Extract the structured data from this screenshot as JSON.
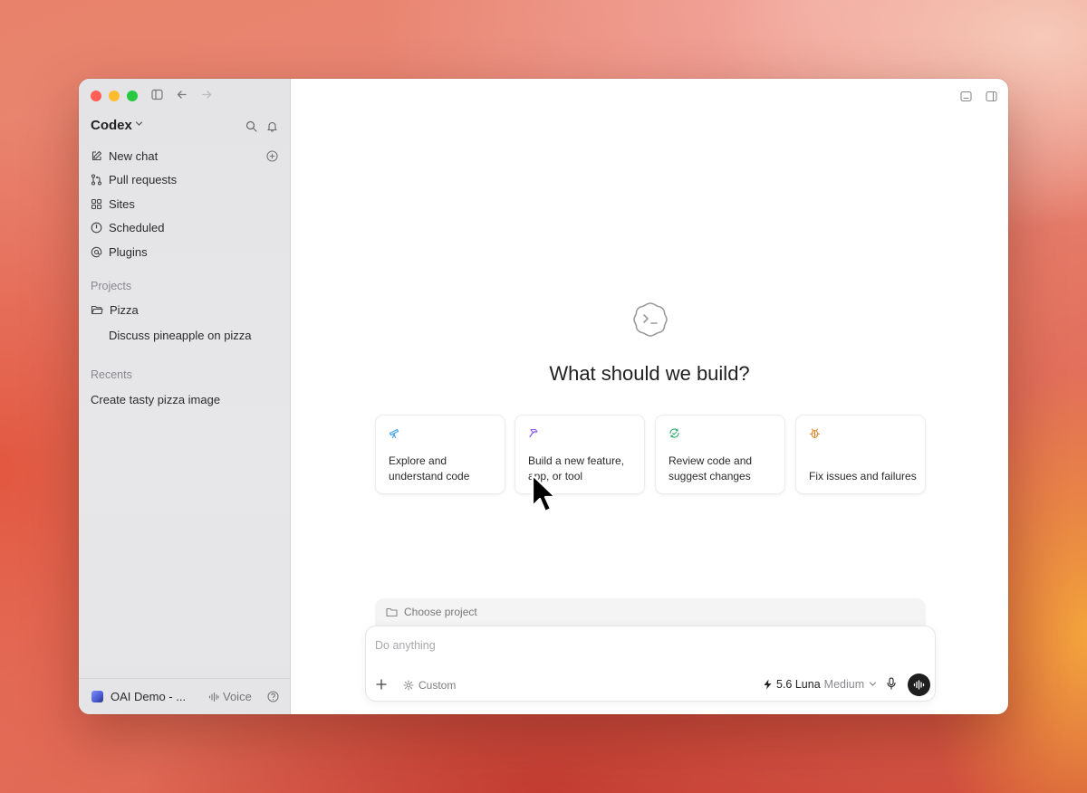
{
  "sidebar": {
    "brand": "Codex",
    "nav": [
      {
        "label": "New chat",
        "icon": "edit-icon"
      },
      {
        "label": "Pull requests",
        "icon": "git-pull-request-icon"
      },
      {
        "label": "Sites",
        "icon": "grid-icon"
      },
      {
        "label": "Scheduled",
        "icon": "clock-icon"
      },
      {
        "label": "Plugins",
        "icon": "at-icon"
      }
    ],
    "projects_label": "Projects",
    "project": {
      "name": "Pizza",
      "thread": "Discuss pineapple on pizza"
    },
    "recents_label": "Recents",
    "recents": [
      "Create tasty pizza image"
    ],
    "footer": {
      "account": "OAI Demo - ...",
      "voice": "Voice"
    }
  },
  "main": {
    "headline": "What should we build?",
    "cards": [
      {
        "text": "Explore and\nunderstand code",
        "icon": "telescope-icon",
        "color": "#3b9ee8"
      },
      {
        "text": "Build a new feature,\napp, or tool",
        "icon": "hammer-icon",
        "color": "#8a5cf0"
      },
      {
        "text": "Review code and\nsuggest changes",
        "icon": "review-icon",
        "color": "#2faa6a"
      },
      {
        "text": "Fix issues and failures",
        "icon": "bug-icon",
        "color": "#e0882a"
      }
    ],
    "choose_project": "Choose project",
    "composer": {
      "placeholder": "Do anything",
      "mode": "Custom",
      "model": "5.6 Luna",
      "effort": "Medium"
    }
  }
}
